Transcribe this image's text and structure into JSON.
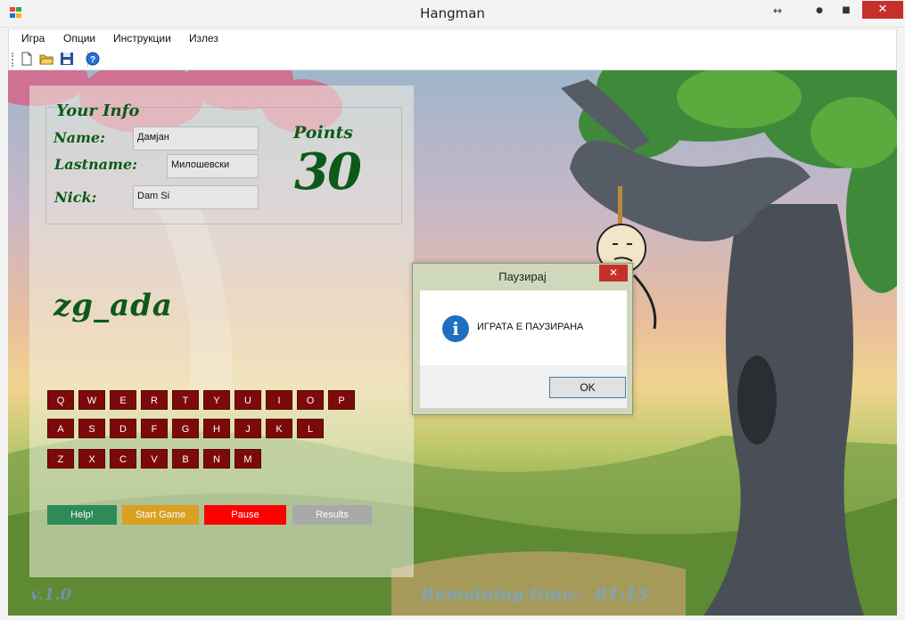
{
  "window": {
    "title": "Hangman",
    "resize_glyph": "↔",
    "minimize_glyph": "●",
    "maximize_glyph": "■",
    "close_glyph": "✕"
  },
  "menu": [
    "Игра",
    "Опции",
    "Инструкции",
    "Излез"
  ],
  "toolbar": {
    "icons": [
      "new-file-icon",
      "open-folder-icon",
      "save-icon",
      "help-icon"
    ]
  },
  "info": {
    "title": "Your Info",
    "name_label": "Name:",
    "name_value": "Дамјан",
    "lastname_label": "Lastname:",
    "lastname_value": "Милошевски",
    "nick_label": "Nick:",
    "nick_value": "Dam Si",
    "points_label": "Points",
    "points_value": "30"
  },
  "game": {
    "word": "zg_ada",
    "keyboard": [
      [
        "Q",
        "W",
        "E",
        "R",
        "T",
        "Y",
        "U",
        "I",
        "O",
        "P"
      ],
      [
        "A",
        "S",
        "D",
        "F",
        "G",
        "H",
        "J",
        "K",
        "L"
      ],
      [
        "Z",
        "X",
        "C",
        "V",
        "B",
        "N",
        "M"
      ]
    ]
  },
  "actions": {
    "help": "Help!",
    "start": "Start Game",
    "pause": "Pause",
    "results": "Results",
    "colors": {
      "help": "#2e8b57",
      "start": "#d9a022",
      "pause": "#ff0000",
      "results": "#a9a9a9"
    }
  },
  "footer": {
    "version": "v.1.0",
    "remaining_label": "Remaining time:",
    "remaining_value": "01:13"
  },
  "dialog": {
    "title": "Паузирај",
    "close_glyph": "✕",
    "icon": "info-icon",
    "icon_glyph": "i",
    "message": "ИГРАТА Е ПАУЗИРАНА",
    "ok_label": "OK"
  }
}
